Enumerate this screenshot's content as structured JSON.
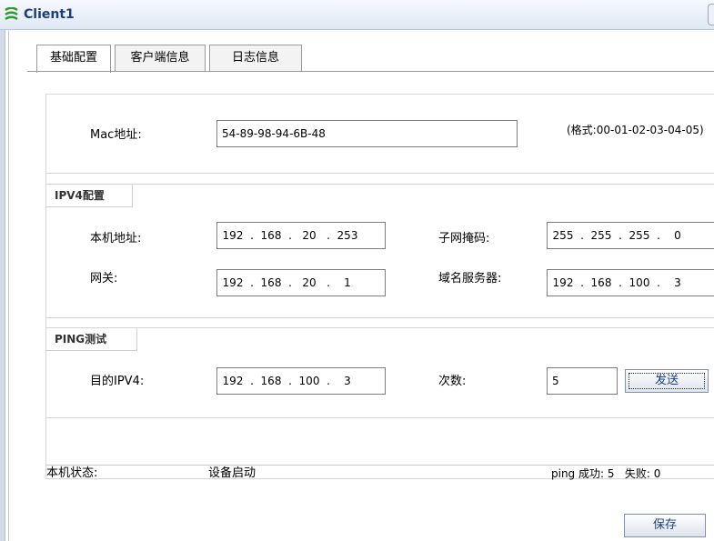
{
  "window": {
    "title": "Client1"
  },
  "tabs": [
    {
      "label": "基础配置",
      "active": true
    },
    {
      "label": "客户端信息",
      "active": false
    },
    {
      "label": "日志信息",
      "active": false
    }
  ],
  "mac": {
    "label": "Mac地址:",
    "value": "54-89-98-94-6B-48",
    "hint": "(格式:00-01-02-03-04-05)"
  },
  "ipv4": {
    "section_label": "IPV4配置",
    "host_ip": {
      "label": "本机地址:",
      "octets": [
        "192",
        "168",
        "20",
        "253"
      ]
    },
    "netmask": {
      "label": "子网掩码:",
      "octets": [
        "255",
        "255",
        "255",
        "0"
      ]
    },
    "gateway": {
      "label": "网关:",
      "octets": [
        "192",
        "168",
        "20",
        "1"
      ]
    },
    "dns": {
      "label": "域名服务器:",
      "octets": [
        "192",
        "168",
        "100",
        "3"
      ]
    }
  },
  "ping": {
    "section_label": "PING测试",
    "dest": {
      "label": "目的IPV4:",
      "octets": [
        "192",
        "168",
        "100",
        "3"
      ]
    },
    "count": {
      "label": "次数:",
      "value": "5"
    },
    "send_label": "发送"
  },
  "status": {
    "label": "本机状态:",
    "value": "设备启动",
    "ping_result": "ping 成功: 5   失败: 0"
  },
  "save_label": "保存",
  "colors": {
    "title_text": "#1c3f7a",
    "button_text": "#1c3f7a"
  }
}
